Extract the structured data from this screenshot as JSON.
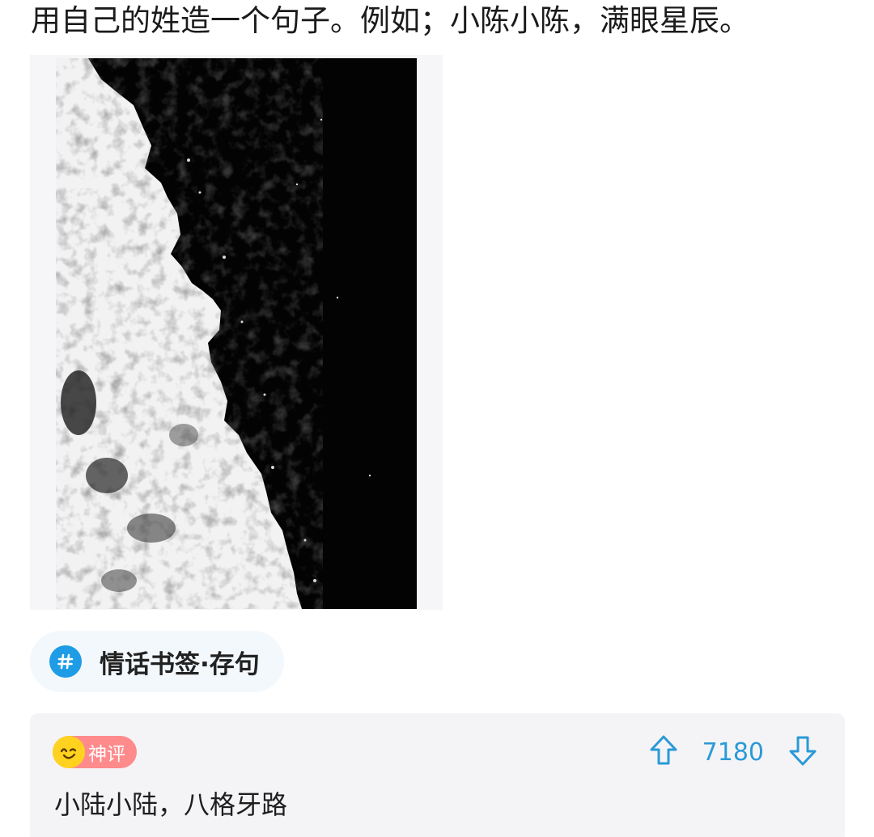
{
  "post": {
    "text": "用自己的姓造一个句子。例如；小陈小陈，满眼星辰。"
  },
  "image": {
    "icon": "ocean-wave-photo"
  },
  "topic": {
    "icon": "hashtag-icon",
    "label": "情话书签·存句"
  },
  "comment": {
    "badge_label": "神评",
    "votes": "7180",
    "text": "小陆小陆，八格牙路"
  },
  "colors": {
    "accent": "#1e9ce6",
    "vote": "#2a9ad6",
    "badge": "#ff8a8c",
    "badge_face": "#ffd21f"
  }
}
